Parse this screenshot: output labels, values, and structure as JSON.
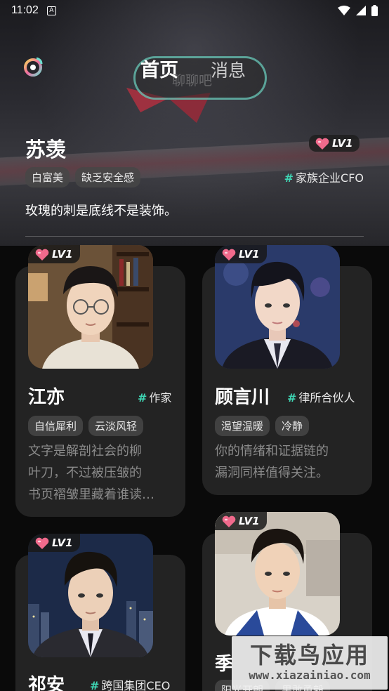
{
  "status_bar": {
    "time": "11:02",
    "notif_glyph": "A"
  },
  "tabs": [
    {
      "label": "首页",
      "active": true
    },
    {
      "label": "消息",
      "active": false
    }
  ],
  "hero": {
    "banner_text": "聊聊吧",
    "name": "苏羡",
    "level": "LV1",
    "tags": [
      "白富美",
      "缺乏安全感"
    ],
    "occupation": "家族企业CFO",
    "quote": "玫瑰的刺是底线不是装饰。"
  },
  "cards": [
    {
      "level": "LV1",
      "name": "江亦",
      "occupation": "作家",
      "tags": [
        "自信犀利",
        "云淡风轻"
      ],
      "desc": [
        "文字是解剖社会的柳",
        "叶刀，不过被压皱的",
        "书页褶皱里藏着谁读…"
      ]
    },
    {
      "level": "LV1",
      "name": "顾言川",
      "occupation": "律所合伙人",
      "tags": [
        "渴望温暖",
        "冷静"
      ],
      "desc": [
        "你的情绪和证据链的",
        "漏洞同样值得关注。"
      ]
    },
    {
      "level": "LV1",
      "name": "祁安",
      "occupation": "跨国集团CEO",
      "tags": [],
      "desc": []
    },
    {
      "level": "LV1",
      "name": "季",
      "occupation": "",
      "tags": [
        "阳光开朗",
        "果敢勇毅"
      ],
      "desc": []
    }
  ],
  "watermark": {
    "title": "下载鸟应用",
    "url": "www.xiazainiao.com"
  },
  "colors": {
    "accent": "#3ed6b4",
    "heart": "#f06a8c",
    "card_bg": "#232323",
    "page_bg": "#0a0a0a"
  }
}
